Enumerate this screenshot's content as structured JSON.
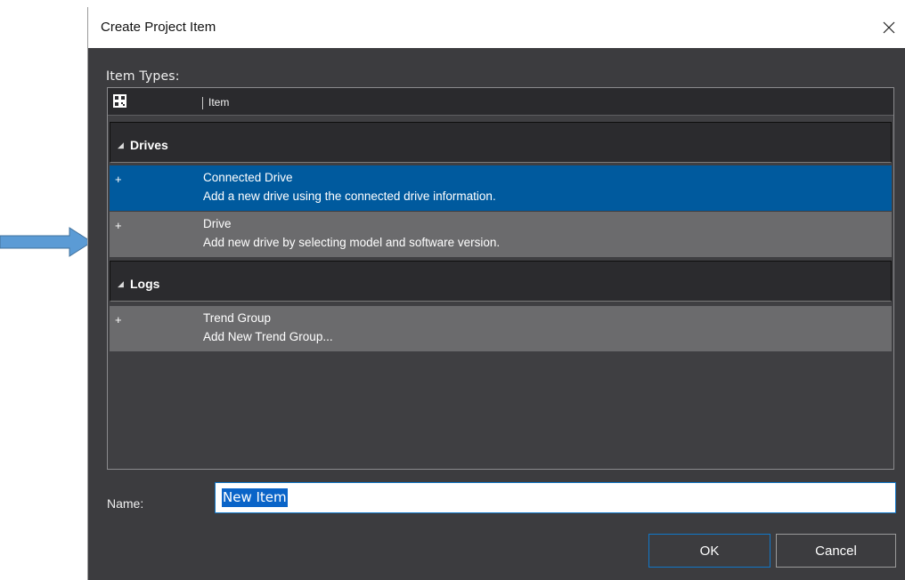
{
  "dialog": {
    "title": "Create Project Item",
    "close_symbol": "✕"
  },
  "item_types": {
    "label": "Item  Types:",
    "header": {
      "icon": "grid-view-icon",
      "item_column": "Item"
    },
    "groups": [
      {
        "name": "Drives",
        "expander": "◢",
        "items": [
          {
            "plus": "+",
            "title": "Connected Drive",
            "description": "Add a new drive using the connected drive information.",
            "selected": true
          },
          {
            "plus": "+",
            "title": "Drive",
            "description": "Add new drive by selecting model and software version.",
            "selected": false
          }
        ]
      },
      {
        "name": "Logs",
        "expander": "◢",
        "items": [
          {
            "plus": "+",
            "title": "Trend Group",
            "description": "Add New Trend Group...",
            "selected": false
          }
        ]
      }
    ]
  },
  "name_field": {
    "label": "Name:",
    "value": "New Item"
  },
  "buttons": {
    "ok": "OK",
    "cancel": "Cancel"
  },
  "colors": {
    "selection": "#005a9e",
    "accent_border": "#1177c8",
    "pointer_arrow": "#5b9bd5"
  }
}
